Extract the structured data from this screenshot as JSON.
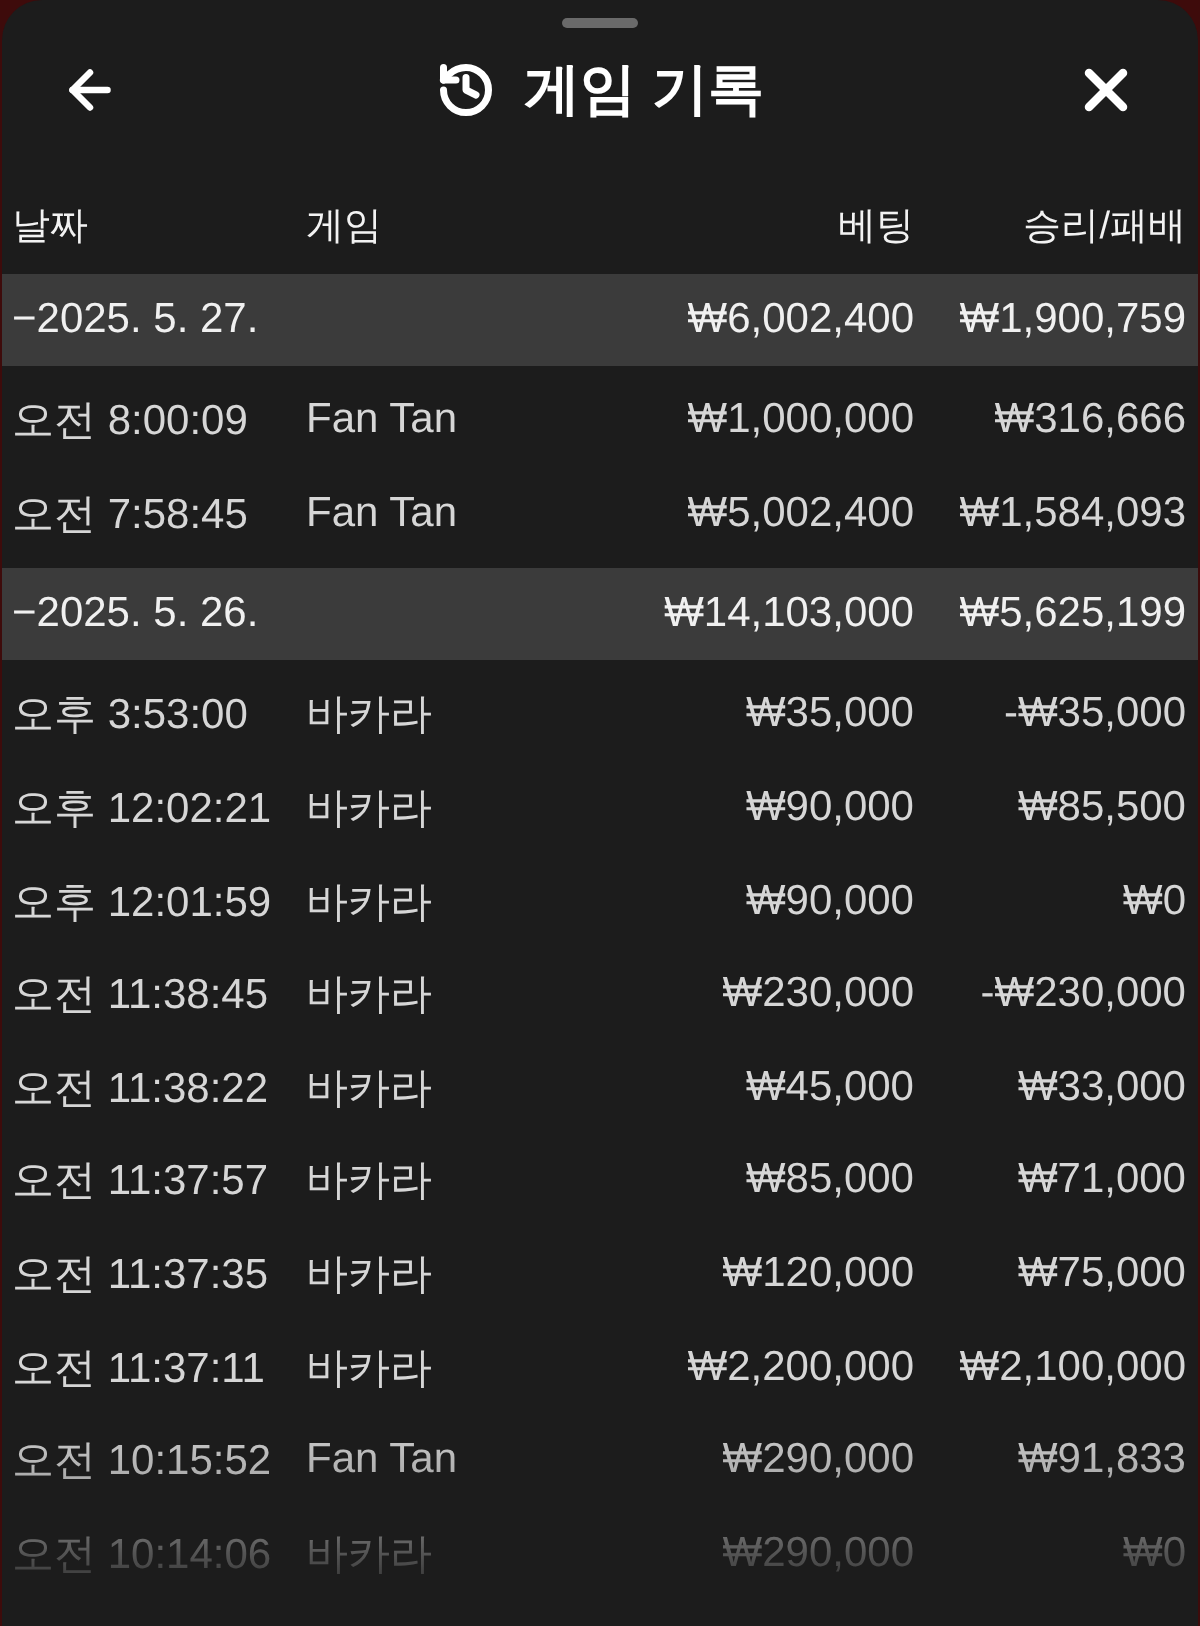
{
  "sheet": {
    "title": "게임 기록"
  },
  "table": {
    "columns": [
      "날짜",
      "게임",
      "베팅",
      "승리/패배"
    ],
    "groups": [
      {
        "date": "−2025. 5. 27.",
        "bet": "₩6,002,400",
        "result": "₩1,900,759",
        "rows": [
          {
            "time": "오전 8:00:09",
            "game": "Fan Tan",
            "bet": "₩1,000,000",
            "result": "₩316,666"
          },
          {
            "time": "오전 7:58:45",
            "game": "Fan Tan",
            "bet": "₩5,002,400",
            "result": "₩1,584,093"
          }
        ]
      },
      {
        "date": "−2025. 5. 26.",
        "bet": "₩14,103,000",
        "result": "₩5,625,199",
        "rows": [
          {
            "time": "오후 3:53:00",
            "game": "바카라",
            "bet": "₩35,000",
            "result": "-₩35,000"
          },
          {
            "time": "오후 12:02:21",
            "game": "바카라",
            "bet": "₩90,000",
            "result": "₩85,500"
          },
          {
            "time": "오후 12:01:59",
            "game": "바카라",
            "bet": "₩90,000",
            "result": "₩0"
          },
          {
            "time": "오전 11:38:45",
            "game": "바카라",
            "bet": "₩230,000",
            "result": "-₩230,000"
          },
          {
            "time": "오전 11:38:22",
            "game": "바카라",
            "bet": "₩45,000",
            "result": "₩33,000"
          },
          {
            "time": "오전 11:37:57",
            "game": "바카라",
            "bet": "₩85,000",
            "result": "₩71,000"
          },
          {
            "time": "오전 11:37:35",
            "game": "바카라",
            "bet": "₩120,000",
            "result": "₩75,000"
          },
          {
            "time": "오전 11:37:11",
            "game": "바카라",
            "bet": "₩2,200,000",
            "result": "₩2,100,000"
          },
          {
            "time": "오전 10:15:52",
            "game": "Fan Tan",
            "bet": "₩290,000",
            "result": "₩91,833"
          },
          {
            "time": "오전 10:14:06",
            "game": "바카라",
            "bet": "₩290,000",
            "result": "₩0"
          }
        ]
      }
    ]
  }
}
